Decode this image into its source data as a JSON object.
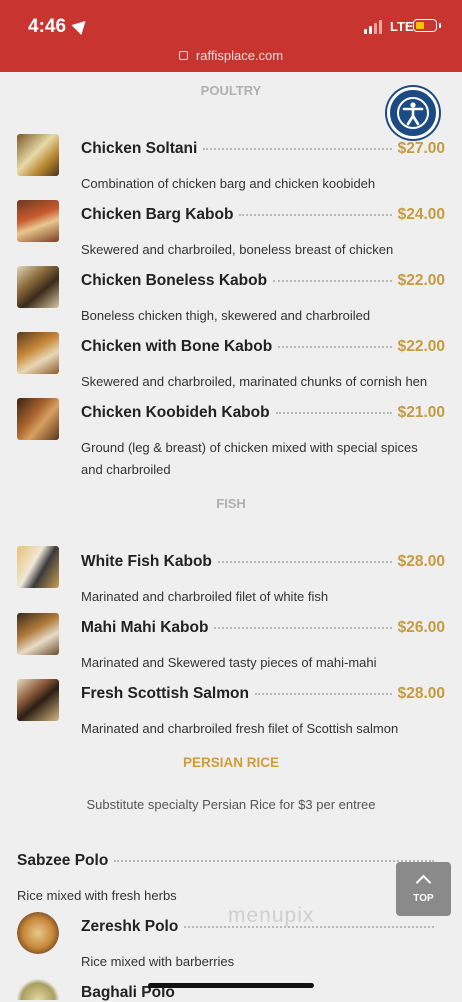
{
  "status_bar": {
    "time": "4:46",
    "network": "LTE",
    "url": "raffisplace.com"
  },
  "sections": {
    "poultry": "POULTRY",
    "fish": "FISH",
    "persian_rice": "PERSIAN RICE"
  },
  "poultry_items": [
    {
      "name": "Chicken Soltani",
      "price": "$27.00",
      "desc": "Combination of chicken barg and chicken koobideh"
    },
    {
      "name": "Chicken Barg Kabob",
      "price": "$24.00",
      "desc": "Skewered and charbroiled, boneless breast of chicken"
    },
    {
      "name": "Chicken Boneless Kabob",
      "price": "$22.00",
      "desc": "Boneless chicken thigh, skewered and charbroiled"
    },
    {
      "name": "Chicken with Bone Kabob",
      "price": "$22.00",
      "desc": "Skewered and charbroiled, marinated chunks of cornish hen"
    },
    {
      "name": "Chicken Koobideh Kabob",
      "price": "$21.00",
      "desc_line1": "Ground (leg & breast) of chicken mixed with special spices",
      "desc_line2": "and charbroiled"
    }
  ],
  "fish_items": [
    {
      "name": "White Fish Kabob",
      "price": "$28.00",
      "desc": "Marinated and charbroiled filet of white fish"
    },
    {
      "name": "Mahi Mahi Kabob",
      "price": "$26.00",
      "desc": "Marinated and Skewered tasty pieces of mahi-mahi"
    },
    {
      "name": "Fresh Scottish Salmon",
      "price": "$28.00",
      "desc": "Marinated and charbroiled fresh filet of Scottish salmon"
    }
  ],
  "rice_note": "Substitute specialty Persian Rice for $3 per entree",
  "rice_items": [
    {
      "name": "Sabzee Polo",
      "desc": "Rice mixed with fresh herbs"
    },
    {
      "name": "Zereshk Polo",
      "desc": "Rice mixed with barberries"
    },
    {
      "name": "Baghali Polo"
    }
  ],
  "top_button": {
    "label": "TOP"
  },
  "watermark": "menupix",
  "colors": {
    "status_bar": "#c8342f",
    "price": "#c69a3f",
    "section_rice": "#d49a3a",
    "accessibility": "#1c4a82"
  },
  "icons": {
    "location": "location-arrow-icon",
    "accessibility": "accessibility-icon",
    "top": "chevron-up-icon",
    "lock": "lock-icon"
  }
}
